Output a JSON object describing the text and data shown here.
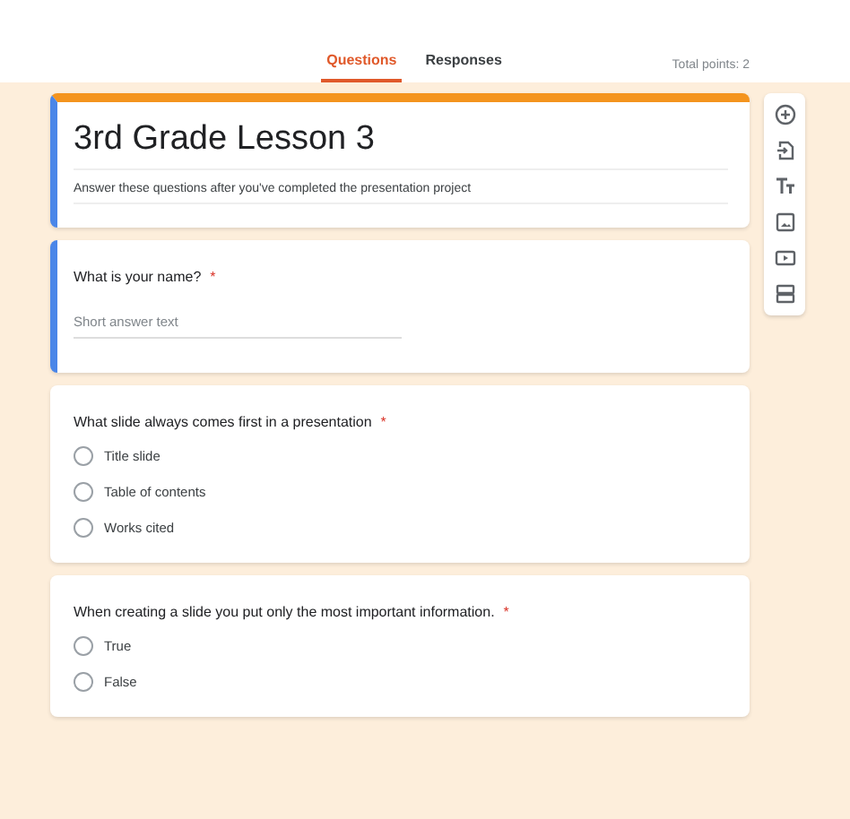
{
  "tabs": [
    {
      "label": "Questions",
      "selected": true
    },
    {
      "label": "Responses",
      "selected": false
    }
  ],
  "total_points": "Total points: 2",
  "form": {
    "title": "3rd Grade Lesson 3",
    "description": "Answer these questions after you've completed the presentation project"
  },
  "questions": [
    {
      "kind": "short",
      "selected": true,
      "text": "What is your name?",
      "required_mark": "*",
      "placeholder": "Short answer text"
    },
    {
      "kind": "choice",
      "selected": false,
      "text": "What slide always comes first in a presentation",
      "required_mark": "*",
      "options": [
        {
          "label": "Title slide",
          "selected": false
        },
        {
          "label": "Table of contents",
          "selected": false
        },
        {
          "label": "Works cited",
          "selected": false
        }
      ]
    },
    {
      "kind": "choice",
      "selected": false,
      "text": "When creating a slide you put only the most important information.",
      "required_mark": "*",
      "options": [
        {
          "label": "True",
          "selected": false
        },
        {
          "label": "False",
          "selected": false
        }
      ]
    }
  ]
}
